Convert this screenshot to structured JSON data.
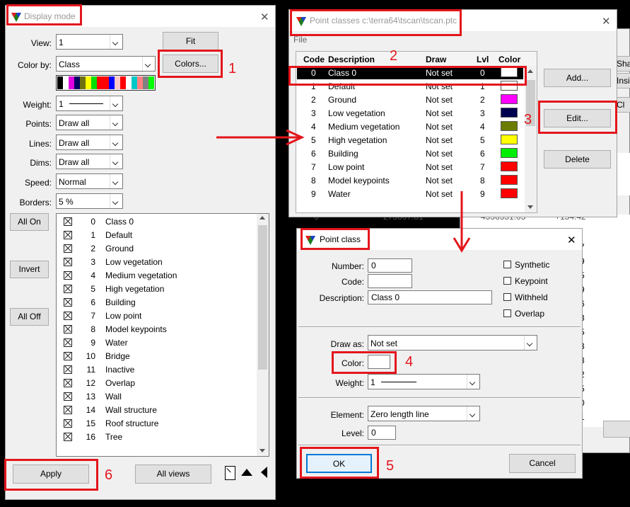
{
  "display_mode": {
    "title": "Display mode",
    "view_label": "View:",
    "view_value": "1",
    "fit_button": "Fit",
    "colorby_label": "Color by:",
    "colorby_value": "Class",
    "colors_button": "Colors...",
    "palette": [
      "#000000",
      "#ffffff",
      "#e000e0",
      "#000060",
      "#707010",
      "#ffff00",
      "#00e000",
      "#ff0000",
      "#ff0000",
      "#0000ff",
      "#ffc8c8",
      "#ff0000",
      "#ffffff",
      "#00c8c8",
      "#ff8080",
      "#808080",
      "#00ff00"
    ],
    "weight_label": "Weight:",
    "weight_value": "1",
    "points_label": "Points:",
    "points_value": "Draw all",
    "lines_label": "Lines:",
    "lines_value": "Draw all",
    "dims_label": "Dims:",
    "dims_value": "Draw all",
    "speed_label": "Speed:",
    "speed_value": "Normal",
    "borders_label": "Borders:",
    "borders_value": "5 %",
    "all_on_button": "All On",
    "invert_button": "Invert",
    "all_off_button": "All Off",
    "classes": [
      {
        "num": "0",
        "name": "Class 0"
      },
      {
        "num": "1",
        "name": "Default"
      },
      {
        "num": "2",
        "name": "Ground"
      },
      {
        "num": "3",
        "name": "Low vegetation"
      },
      {
        "num": "4",
        "name": "Medium vegetation"
      },
      {
        "num": "5",
        "name": "High vegetation"
      },
      {
        "num": "6",
        "name": "Building"
      },
      {
        "num": "7",
        "name": "Low point"
      },
      {
        "num": "8",
        "name": "Model keypoints"
      },
      {
        "num": "9",
        "name": "Water"
      },
      {
        "num": "10",
        "name": "Bridge"
      },
      {
        "num": "11",
        "name": "Inactive"
      },
      {
        "num": "12",
        "name": "Overlap"
      },
      {
        "num": "13",
        "name": "Wall"
      },
      {
        "num": "14",
        "name": "Wall structure"
      },
      {
        "num": "15",
        "name": "Roof structure"
      },
      {
        "num": "16",
        "name": "Tree"
      }
    ],
    "apply_button": "Apply",
    "all_views_button": "All views"
  },
  "point_classes": {
    "title": "Point classes c:\\terra64\\tscan\\tscan.ptc",
    "menu_file": "File",
    "headers": {
      "code": "Code",
      "description": "Description",
      "draw": "Draw",
      "lvl": "Lvl",
      "color": "Color"
    },
    "rows": [
      {
        "code": "0",
        "description": "Class 0",
        "draw": "Not set",
        "lvl": "0",
        "color": "#ffffff"
      },
      {
        "code": "1",
        "description": "Default",
        "draw": "Not set",
        "lvl": "1",
        "color": "#ffffff"
      },
      {
        "code": "2",
        "description": "Ground",
        "draw": "Not set",
        "lvl": "2",
        "color": "#ff00ff"
      },
      {
        "code": "3",
        "description": "Low vegetation",
        "draw": "Not set",
        "lvl": "3",
        "color": "#000050"
      },
      {
        "code": "4",
        "description": "Medium vegetation",
        "draw": "Not set",
        "lvl": "4",
        "color": "#6b7c00"
      },
      {
        "code": "5",
        "description": "High vegetation",
        "draw": "Not set",
        "lvl": "5",
        "color": "#ffff00"
      },
      {
        "code": "6",
        "description": "Building",
        "draw": "Not set",
        "lvl": "6",
        "color": "#00ee00"
      },
      {
        "code": "7",
        "description": "Low point",
        "draw": "Not set",
        "lvl": "7",
        "color": "#ff0000"
      },
      {
        "code": "8",
        "description": "Model keypoints",
        "draw": "Not set",
        "lvl": "8",
        "color": "#ff0000"
      },
      {
        "code": "9",
        "description": "Water",
        "draw": "Not set",
        "lvl": "9",
        "color": "#ff0000"
      }
    ],
    "add_button": "Add...",
    "edit_button": "Edit...",
    "delete_button": "Delete"
  },
  "point_class": {
    "title": "Point class",
    "number_label": "Number:",
    "number_value": "0",
    "code_label": "Code:",
    "code_value": "",
    "description_label": "Description:",
    "description_value": "Class 0",
    "synthetic_label": "Synthetic",
    "keypoint_label": "Keypoint",
    "withheld_label": "Withheld",
    "overlap_label": "Overlap",
    "drawas_label": "Draw as:",
    "drawas_value": "Not set",
    "color_label": "Color:",
    "weight_label": "Weight:",
    "weight_value": "1",
    "element_label": "Element:",
    "element_value": "Zero length line",
    "level_label": "Level:",
    "level_value": "0",
    "ok_button": "OK",
    "cancel_button": "Cancel"
  },
  "background": {
    "partial_labels": [
      "Sha",
      "Insi",
      "Cl"
    ],
    "table_row": [
      "0",
      "275007.81",
      "4556551.05",
      "+154.42"
    ],
    "digits": [
      "7",
      "9",
      "5",
      "9",
      "6",
      "3",
      "5",
      "3",
      "8",
      "2",
      "5",
      "0",
      "1"
    ]
  },
  "callouts": [
    "1",
    "2",
    "3",
    "4",
    "5",
    "6"
  ]
}
